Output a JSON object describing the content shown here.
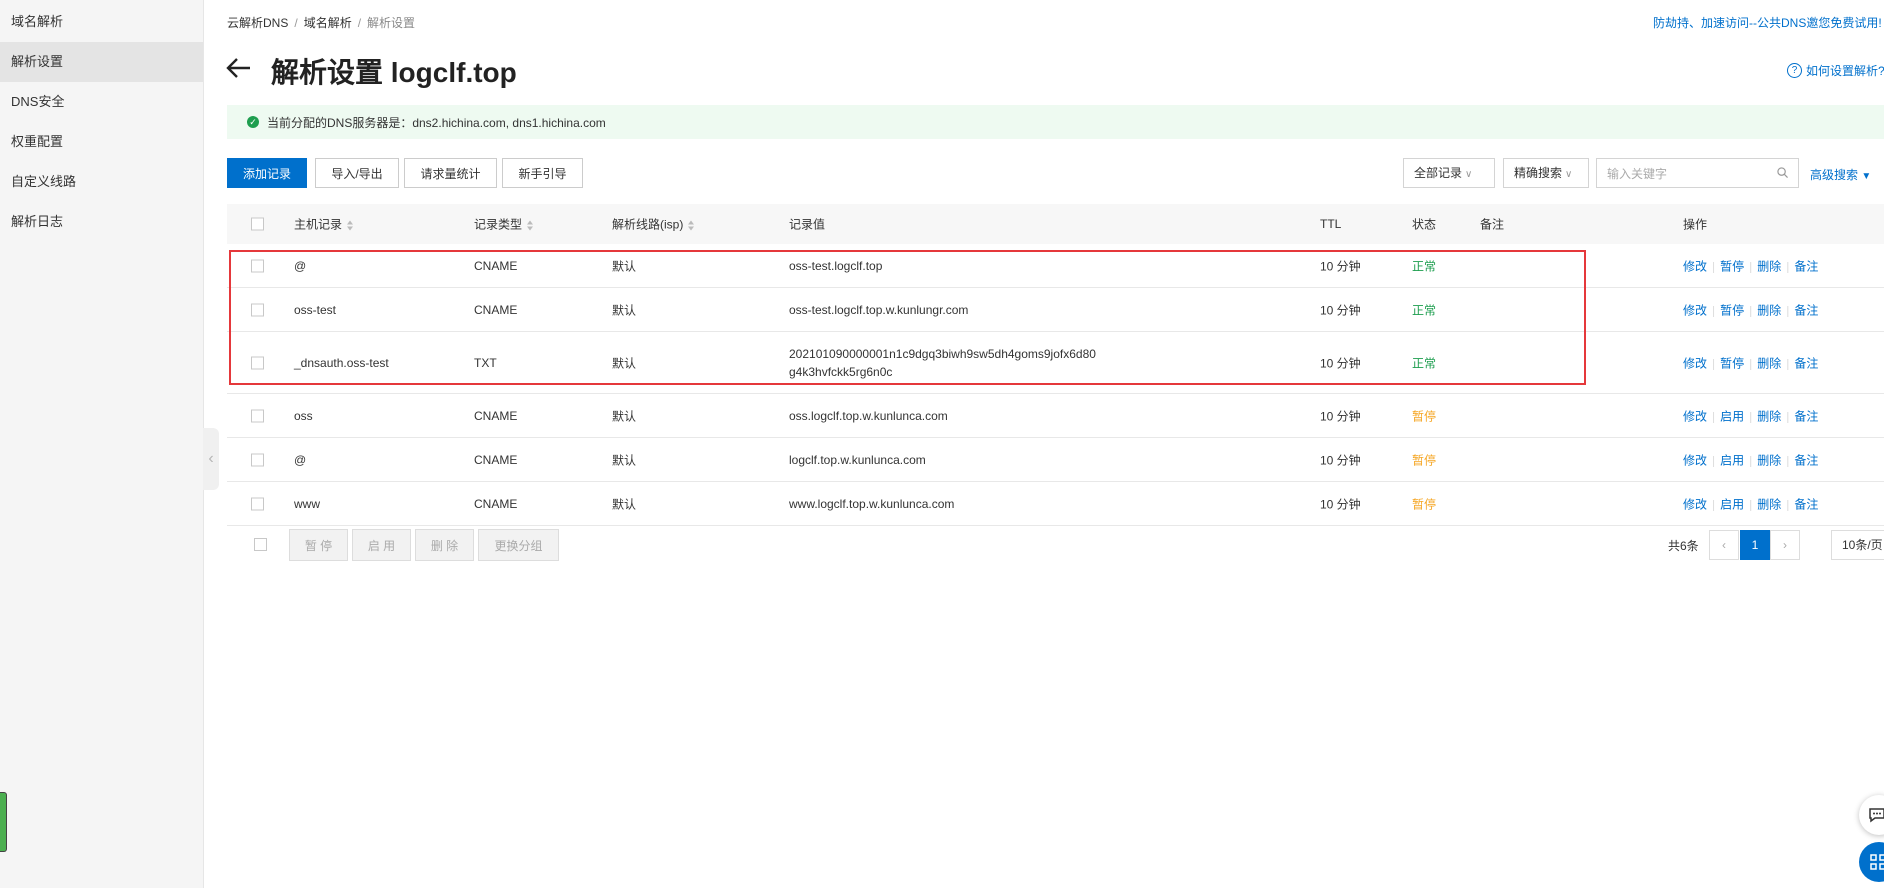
{
  "sidebar": {
    "items": [
      {
        "label": "域名解析"
      },
      {
        "label": "解析设置"
      },
      {
        "label": "DNS安全"
      },
      {
        "label": "权重配置"
      },
      {
        "label": "自定义线路"
      },
      {
        "label": "解析日志"
      }
    ]
  },
  "breadcrumb": [
    "云解析DNS",
    "域名解析",
    "解析设置"
  ],
  "top_link": "防劫持、加速访问--公共DNS邀您免费试用!",
  "page_title": "解析设置 logclf.top",
  "help_link": "如何设置解析?",
  "notice": {
    "text": "当前分配的DNS服务器是：dns2.hichina.com, dns1.hichina.com"
  },
  "toolbar": {
    "add": "添加记录",
    "import_export": "导入/导出",
    "stats": "请求量统计",
    "guide": "新手引导",
    "filter_all": "全部记录",
    "exact_search": "精确搜索",
    "search_placeholder": "输入关键字",
    "advanced": "高级搜索"
  },
  "table": {
    "headers": {
      "host": "主机记录",
      "type": "记录类型",
      "line": "解析线路(isp)",
      "value": "记录值",
      "ttl": "TTL",
      "status": "状态",
      "remark": "备注",
      "ops": "操作"
    },
    "rows": [
      {
        "host": "@",
        "type": "CNAME",
        "line": "默认",
        "value": "oss-test.logclf.top",
        "value2": "",
        "ttl": "10 分钟",
        "status": "正常",
        "status_kind": "ok",
        "ops": [
          "修改",
          "暂停",
          "删除",
          "备注"
        ]
      },
      {
        "host": "oss-test",
        "type": "CNAME",
        "line": "默认",
        "value": "oss-test.logclf.top.w.kunlungr.com",
        "value2": "",
        "ttl": "10 分钟",
        "status": "正常",
        "status_kind": "ok",
        "ops": [
          "修改",
          "暂停",
          "删除",
          "备注"
        ]
      },
      {
        "host": "_dnsauth.oss-test",
        "type": "TXT",
        "line": "默认",
        "value": "202101090000001n1c9dgq3biwh9sw5dh4goms9jofx6d80",
        "value2": "g4k3hvfckk5rg6n0c",
        "ttl": "10 分钟",
        "status": "正常",
        "status_kind": "ok",
        "ops": [
          "修改",
          "暂停",
          "删除",
          "备注"
        ]
      },
      {
        "host": "oss",
        "type": "CNAME",
        "line": "默认",
        "value": "oss.logclf.top.w.kunlunca.com",
        "value2": "",
        "ttl": "10 分钟",
        "status": "暂停",
        "status_kind": "pause",
        "ops": [
          "修改",
          "启用",
          "删除",
          "备注"
        ]
      },
      {
        "host": "@",
        "type": "CNAME",
        "line": "默认",
        "value": "logclf.top.w.kunlunca.com",
        "value2": "",
        "ttl": "10 分钟",
        "status": "暂停",
        "status_kind": "pause",
        "ops": [
          "修改",
          "启用",
          "删除",
          "备注"
        ]
      },
      {
        "host": "www",
        "type": "CNAME",
        "line": "默认",
        "value": "www.logclf.top.w.kunlunca.com",
        "value2": "",
        "ttl": "10 分钟",
        "status": "暂停",
        "status_kind": "pause",
        "ops": [
          "修改",
          "启用",
          "删除",
          "备注"
        ]
      }
    ]
  },
  "footer": {
    "pause": "暂 停",
    "enable": "启 用",
    "delete": "删 除",
    "change_group": "更换分组",
    "total": "共6条",
    "current_page": "1",
    "page_size": "10条/页"
  },
  "colors": {
    "accent": "#0070cc",
    "ok": "#1e9e4f",
    "pause": "#f5a623",
    "highlight": "#e5383b"
  }
}
